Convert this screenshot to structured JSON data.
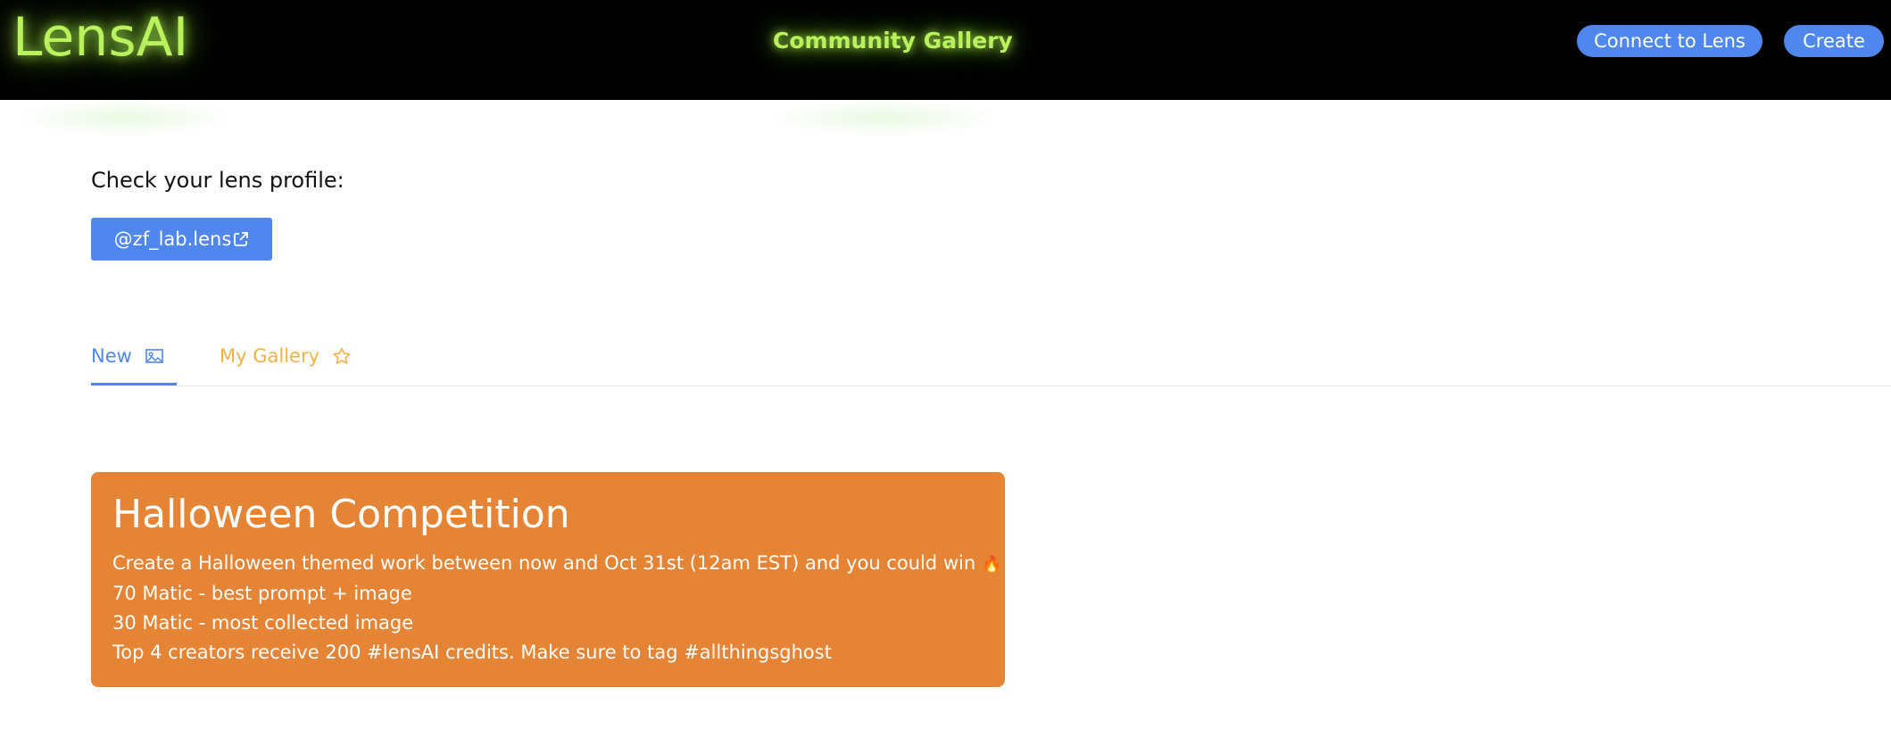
{
  "header": {
    "logo": "LensAI",
    "title": "Community Gallery",
    "connect_label": "Connect to Lens",
    "create_label": "Create"
  },
  "profile": {
    "label": "Check your lens profile:",
    "handle": "@zf_lab.lens",
    "icon": "external-link-icon"
  },
  "tabs": [
    {
      "label": "New",
      "icon": "image-icon",
      "active": true,
      "color": "#4f87ee"
    },
    {
      "label": "My Gallery",
      "icon": "star-icon",
      "active": false,
      "color": "#f0b347"
    }
  ],
  "banner": {
    "title": "Halloween Competition",
    "line1": "Create a Halloween themed work between now and Oct 31st (12am EST) and you could win",
    "line1_icon": "fire-icon",
    "line2": "70 Matic - best prompt + image",
    "line3": "30 Matic - most collected image",
    "line4": "Top 4 creators receive 200 #lensAI credits. Make sure to tag #allthingsghost",
    "background": "#e68436"
  },
  "colors": {
    "accent": "#4f87ee",
    "neon": "#b8f25c",
    "gallery_tab": "#f0b347"
  }
}
